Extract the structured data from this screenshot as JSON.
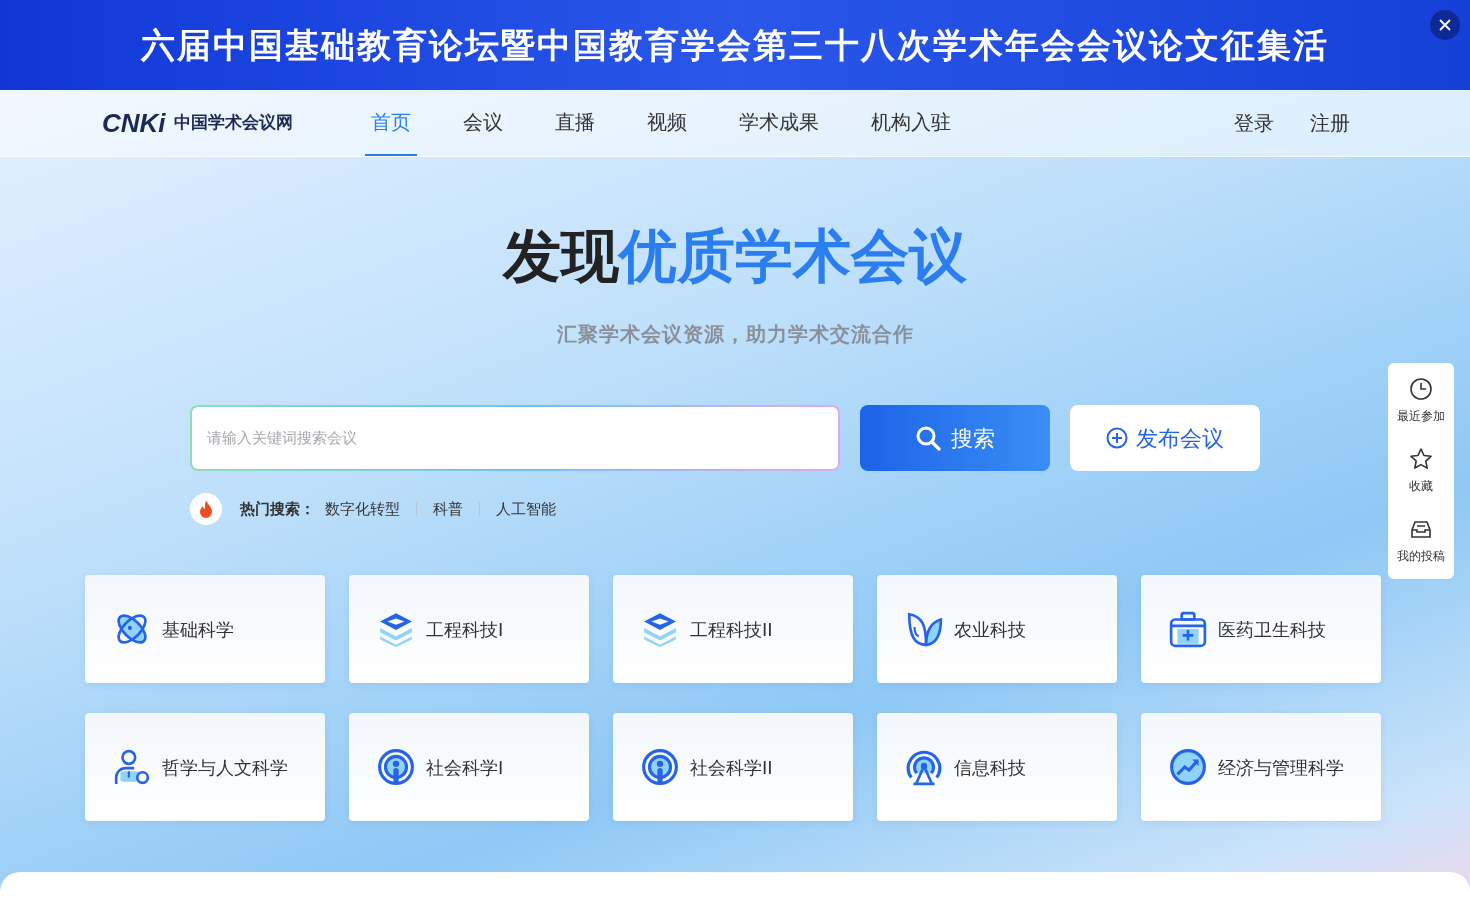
{
  "banner": {
    "text": "六届中国基础教育论坛暨中国教育学会第三十八次学术年会会议论文征集活"
  },
  "header": {
    "logo_mark": "CNKi",
    "logo_text": "中国学术会议网",
    "nav": [
      {
        "label": "首页",
        "selected": true
      },
      {
        "label": "会议",
        "selected": false
      },
      {
        "label": "直播",
        "selected": false
      },
      {
        "label": "视频",
        "selected": false
      },
      {
        "label": "学术成果",
        "selected": false
      },
      {
        "label": "机构入驻",
        "selected": false
      }
    ],
    "auth": [
      "登录",
      "注册"
    ]
  },
  "hero": {
    "title_lead": "发现",
    "title_highlight": "优质学术会议",
    "subtitle": "汇聚学术会议资源，助力学术交流合作"
  },
  "search": {
    "placeholder": "请输入关键词搜索会议",
    "button": "搜索",
    "publish_button": "发布会议"
  },
  "hot": {
    "label": "热门搜索：",
    "terms": [
      "数字化转型",
      "科普",
      "人工智能"
    ]
  },
  "categories": [
    {
      "label": "基础科学"
    },
    {
      "label": "工程科技I"
    },
    {
      "label": "工程科技II"
    },
    {
      "label": "农业科技"
    },
    {
      "label": "医药卫生科技"
    },
    {
      "label": "哲学与人文科学"
    },
    {
      "label": "社会科学I"
    },
    {
      "label": "社会科学II"
    },
    {
      "label": "信息科技"
    },
    {
      "label": "经济与管理科学"
    }
  ],
  "side_panel": [
    {
      "label": "最近参加"
    },
    {
      "label": "收藏"
    },
    {
      "label": "我的投稿"
    }
  ]
}
